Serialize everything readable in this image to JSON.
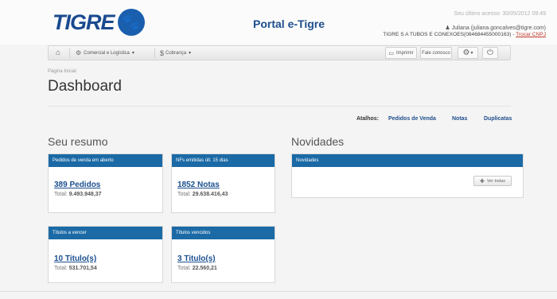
{
  "header": {
    "logo_text": "TIGRE",
    "portal_title": "Portal e-Tigre",
    "last_access": "Seu último acesso: 30/05/2012 09:49",
    "user": "Juliana (juliana.goncalves@tigre.com)",
    "company": "TIGRE S A TUBOS E CONEXOES(084684455000163) -",
    "change_cnpj": "Trocar CNPJ"
  },
  "toolbar": {
    "menu_comercial": "Comercial e Logística",
    "menu_cobranca": "Cobrança",
    "print_label": "Imprimir",
    "contact_label": "Fale conosco"
  },
  "page": {
    "breadcrumb": "Página Inicial",
    "title": "Dashboard"
  },
  "shortcuts": {
    "label": "Atalhos:",
    "links": [
      "Pedidos de Venda",
      "Notas",
      "Duplicatas"
    ]
  },
  "summary": {
    "title": "Seu resumo",
    "cards": [
      {
        "header": "Pedidos de venda em aberto",
        "link": "389 Pedidos",
        "total_label": "Total:",
        "total_value": "9.493.948,37"
      },
      {
        "header": "NFs emitidas últ. 15 dias",
        "link": "1852 Notas",
        "total_label": "Total:",
        "total_value": "29.638.416,43"
      },
      {
        "header": "Títulos a vencer",
        "link": "10 Titulo(s)",
        "total_label": "Total:",
        "total_value": "531.701,54"
      },
      {
        "header": "Títulos vencidos",
        "link": "3 Titulo(s)",
        "total_label": "Total:",
        "total_value": "22.560,21"
      }
    ]
  },
  "news": {
    "title": "Novidades",
    "header": "Novidades",
    "button": "Ver todas"
  }
}
